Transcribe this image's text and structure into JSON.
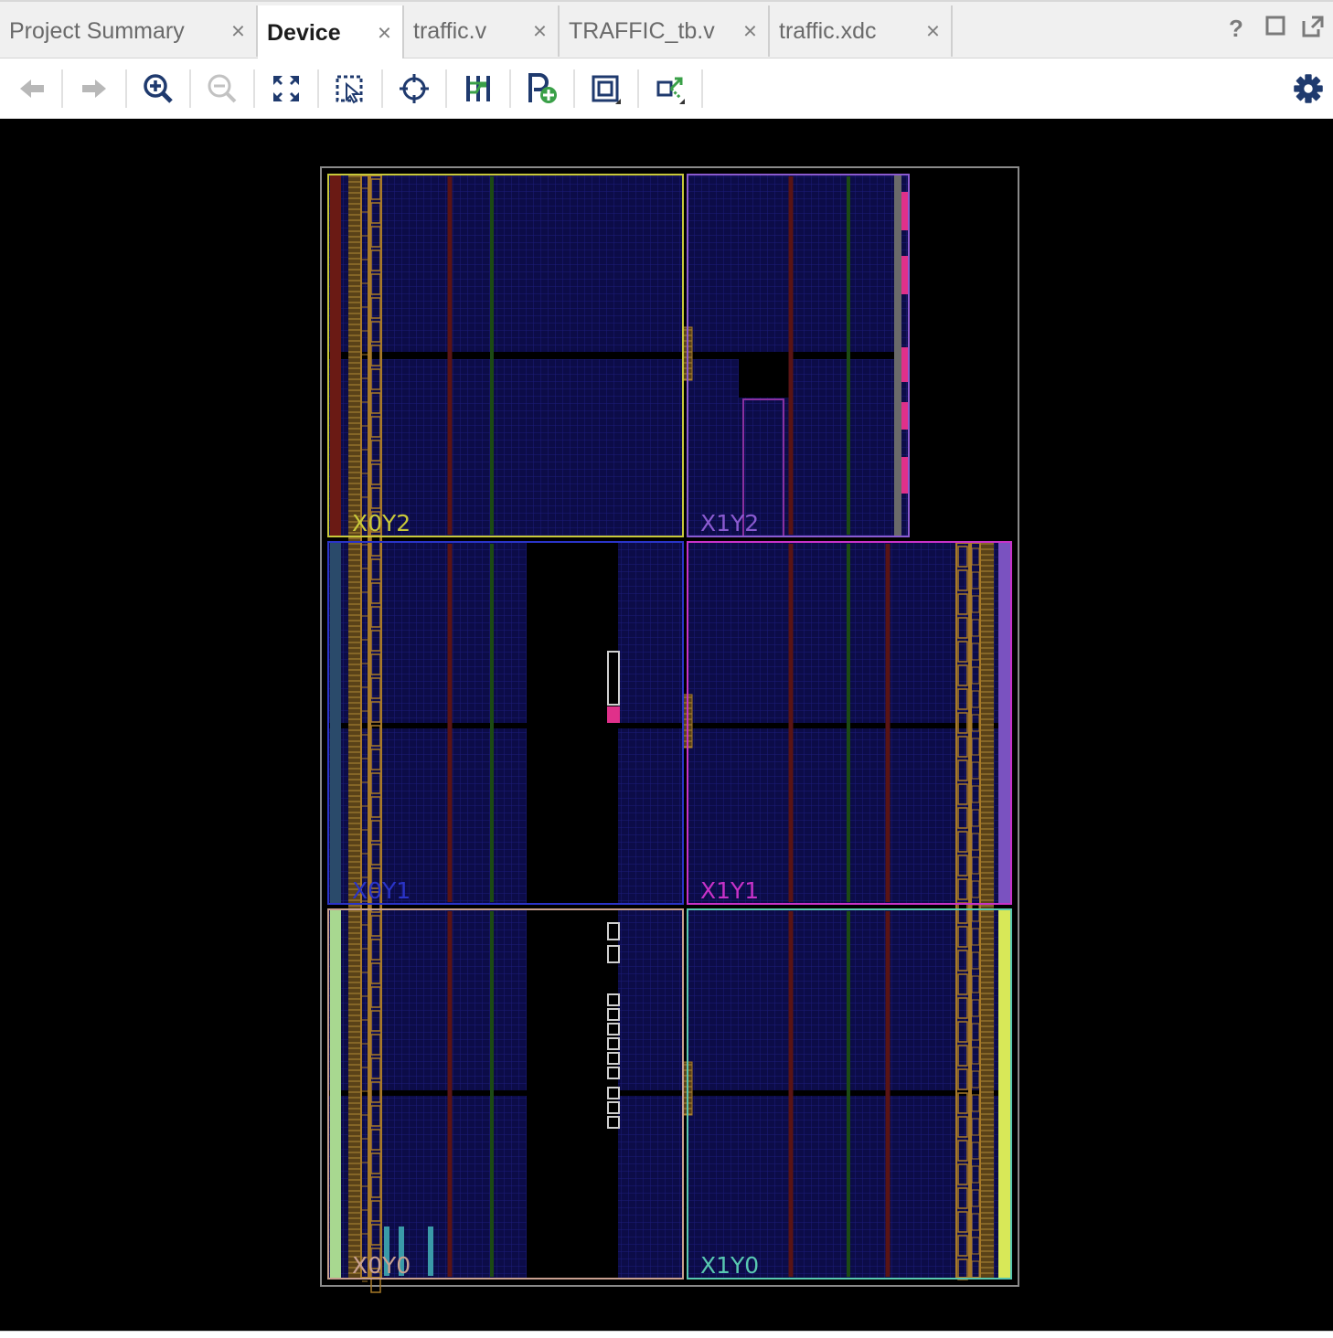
{
  "tabs": [
    {
      "label": "Project Summary",
      "active": false
    },
    {
      "label": "Device",
      "active": true
    },
    {
      "label": "traffic.v",
      "active": false
    },
    {
      "label": "TRAFFIC_tb.v",
      "active": false
    },
    {
      "label": "traffic.xdc",
      "active": false
    }
  ],
  "tab_close_glyph": "×",
  "window_controls": {
    "help": "?",
    "maximize": "□",
    "float": "⧉"
  },
  "toolbar": {
    "buttons": [
      {
        "icon": "back-arrow-icon",
        "enabled": false
      },
      {
        "icon": "forward-arrow-icon",
        "enabled": false
      },
      {
        "icon": "zoom-in-icon",
        "enabled": true
      },
      {
        "icon": "zoom-out-icon",
        "enabled": false
      },
      {
        "icon": "zoom-fit-icon",
        "enabled": true
      },
      {
        "icon": "zoom-to-selected-icon",
        "enabled": true
      },
      {
        "icon": "autofit-selection-icon",
        "enabled": true
      },
      {
        "icon": "routing-resources-icon",
        "enabled": true
      },
      {
        "icon": "add-pblock-icon",
        "enabled": true
      },
      {
        "icon": "draw-pblock-icon",
        "enabled": true
      },
      {
        "icon": "select-nets-icon",
        "enabled": true
      }
    ],
    "settings_icon": "gear-icon"
  },
  "device": {
    "clock_regions": [
      {
        "label": "X0Y2",
        "color": "#c8c83a"
      },
      {
        "label": "X1Y2",
        "color": "#8a5ad0"
      },
      {
        "label": "X0Y1",
        "color": "#2a34c8"
      },
      {
        "label": "X1Y1",
        "color": "#c832c8"
      },
      {
        "label": "X0Y0",
        "color": "#c8a090"
      },
      {
        "label": "X1Y0",
        "color": "#58c8b0"
      }
    ],
    "fabric_color": "#0c0c48",
    "grid_color": "#1c1c7a",
    "bram_column_color": "#5a1414",
    "dsp_column_color": "#1c4a14",
    "io_color": "#a87a28",
    "highlight_color": "#e0308a"
  }
}
